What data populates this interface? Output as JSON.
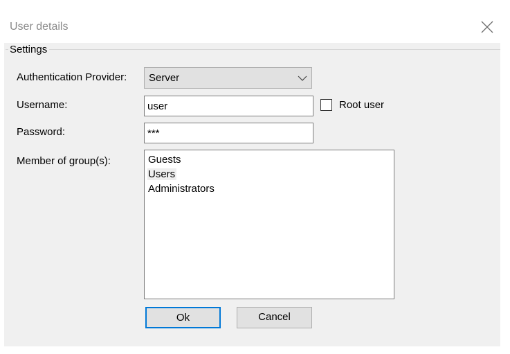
{
  "window": {
    "title": "User details"
  },
  "settings": {
    "caption": "Settings",
    "auth_provider": {
      "label": "Authentication Provider:",
      "selected": "Server"
    },
    "username": {
      "label": "Username:",
      "value": "user"
    },
    "root_user": {
      "label": "Root user",
      "checked": false
    },
    "password": {
      "label": "Password:",
      "value": "***"
    },
    "groups": {
      "label": "Member of group(s):",
      "items": [
        {
          "label": "Guests",
          "selected": false
        },
        {
          "label": "Users",
          "selected": true
        },
        {
          "label": "Administrators",
          "selected": false
        }
      ]
    }
  },
  "buttons": {
    "ok": "Ok",
    "cancel": "Cancel"
  },
  "icons": {
    "close": "close-icon",
    "dropdown": "chevron-down-icon"
  },
  "colors": {
    "client_bg": "#f0f0f0",
    "control_bg": "#e1e1e1",
    "focus_border": "#0078d7",
    "title_text": "#8a8a8a"
  }
}
